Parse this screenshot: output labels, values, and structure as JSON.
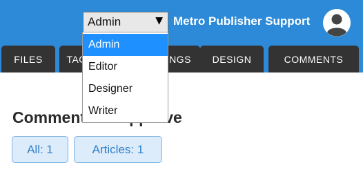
{
  "header": {
    "role_select": {
      "value": "Admin",
      "caret": "▼"
    },
    "support_name": "Metro Publisher Support",
    "avatar_icon": "user-avatar-icon",
    "colors": {
      "bar": "#2d8ad8",
      "tab": "#333333"
    }
  },
  "tabs": [
    {
      "label": "FILES"
    },
    {
      "label": "TAGS"
    },
    {
      "label": "SETTINGS"
    },
    {
      "label": "DESIGN"
    },
    {
      "label": "COMMENTS"
    }
  ],
  "main": {
    "title": "Comments to Approve",
    "filters": [
      {
        "label": "All: 1"
      },
      {
        "label": "Articles: 1"
      }
    ]
  },
  "dropdown": {
    "options": [
      {
        "label": "Admin",
        "selected": true
      },
      {
        "label": "Editor",
        "selected": false
      },
      {
        "label": "Designer",
        "selected": false
      },
      {
        "label": "Writer",
        "selected": false
      }
    ]
  }
}
